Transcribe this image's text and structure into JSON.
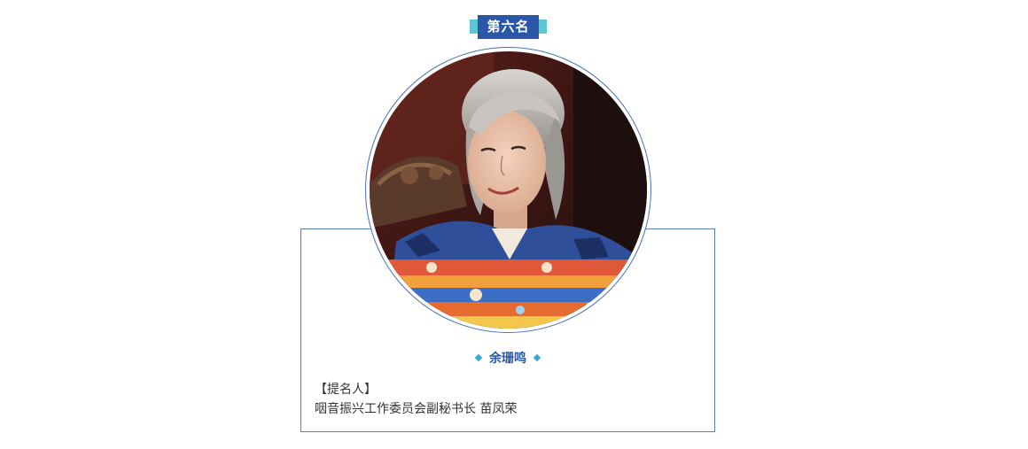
{
  "rank": {
    "label": "第六名"
  },
  "person": {
    "name": "余珊鸣"
  },
  "nominator": {
    "heading": "【提名人】",
    "detail": "咽音振兴工作委员会副秘书长 苗凤荣"
  },
  "colors": {
    "primary_blue": "#2b57a8",
    "accent_teal": "#5fc7d3",
    "diamond_blue": "#3aa6de",
    "border_blue": "#5a7fb8",
    "text_dark": "#333333"
  }
}
